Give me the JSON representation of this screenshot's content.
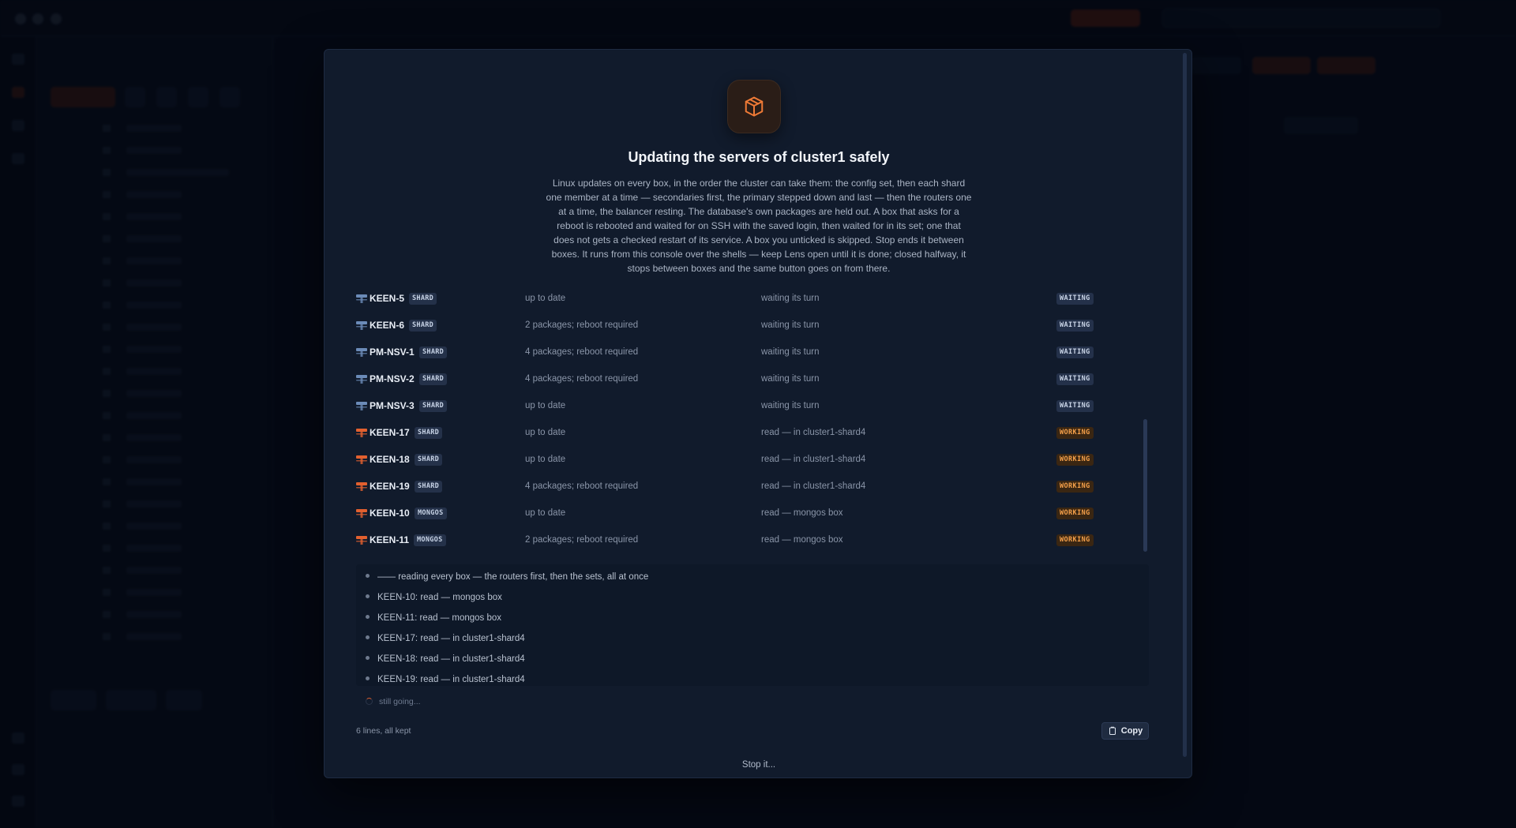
{
  "modal": {
    "icon": "package-icon",
    "title": "Updating the servers of cluster1 safely",
    "description": "Linux updates on every box, in the order the cluster can take them: the config set, then each shard one member at a time — secondaries first, the primary stepped down and last — then the routers one at a time, the balancer resting. The database's own packages are held out. A box that asks for a reboot is rebooted and waited for on SSH with the saved login, then waited for in its set; one that does not gets a checked restart of its service. A box you unticked is skipped. Stop ends it between boxes. It runs from this console over the shells — keep Lens open until it is done; closed halfway, it stops between boxes and the same button goes on from there.",
    "rows": [
      {
        "name": "KEEN-5",
        "tag": "SHARD",
        "packages": "up to date",
        "status": "waiting its turn",
        "badge": "WAITING",
        "kind": "waiting"
      },
      {
        "name": "KEEN-6",
        "tag": "SHARD",
        "packages": "2 packages; reboot required",
        "status": "waiting its turn",
        "badge": "WAITING",
        "kind": "waiting"
      },
      {
        "name": "PM-NSV-1",
        "tag": "SHARD",
        "packages": "4 packages; reboot required",
        "status": "waiting its turn",
        "badge": "WAITING",
        "kind": "waiting"
      },
      {
        "name": "PM-NSV-2",
        "tag": "SHARD",
        "packages": "4 packages; reboot required",
        "status": "waiting its turn",
        "badge": "WAITING",
        "kind": "waiting"
      },
      {
        "name": "PM-NSV-3",
        "tag": "SHARD",
        "packages": "up to date",
        "status": "waiting its turn",
        "badge": "WAITING",
        "kind": "waiting"
      },
      {
        "name": "KEEN-17",
        "tag": "SHARD",
        "packages": "up to date",
        "status": "read — in cluster1-shard4",
        "badge": "WORKING",
        "kind": "working"
      },
      {
        "name": "KEEN-18",
        "tag": "SHARD",
        "packages": "up to date",
        "status": "read — in cluster1-shard4",
        "badge": "WORKING",
        "kind": "working"
      },
      {
        "name": "KEEN-19",
        "tag": "SHARD",
        "packages": "4 packages; reboot required",
        "status": "read — in cluster1-shard4",
        "badge": "WORKING",
        "kind": "working"
      },
      {
        "name": "KEEN-10",
        "tag": "MONGOS",
        "packages": "up to date",
        "status": "read — mongos box",
        "badge": "WORKING",
        "kind": "working"
      },
      {
        "name": "KEEN-11",
        "tag": "MONGOS",
        "packages": "2 packages; reboot required",
        "status": "read — mongos box",
        "badge": "WORKING",
        "kind": "working"
      }
    ],
    "log": [
      "—— reading every box — the routers first, then the sets, all at once",
      "KEEN-10: read — mongos box",
      "KEEN-11: read — mongos box",
      "KEEN-17: read — in cluster1-shard4",
      "KEEN-18: read — in cluster1-shard4",
      "KEEN-19: read — in cluster1-shard4"
    ],
    "log_status": "still going...",
    "footer_note": "6 lines, all kept",
    "copy_label": "Copy",
    "stop_label": "Stop it..."
  },
  "colors": {
    "accent": "#e2602f",
    "working": "#f5a04a",
    "waiting_icon": "#6b8bb8",
    "working_icon": "#e2602f"
  }
}
